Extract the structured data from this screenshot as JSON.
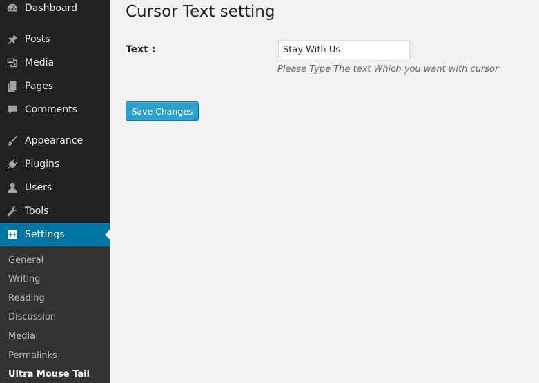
{
  "sidebar": {
    "items": [
      {
        "label": "Dashboard",
        "icon": "dashboard-icon"
      },
      {
        "label": "Posts",
        "icon": "pin-icon"
      },
      {
        "label": "Media",
        "icon": "media-icon"
      },
      {
        "label": "Pages",
        "icon": "pages-icon"
      },
      {
        "label": "Comments",
        "icon": "comment-icon"
      },
      {
        "label": "Appearance",
        "icon": "brush-icon"
      },
      {
        "label": "Plugins",
        "icon": "plug-icon"
      },
      {
        "label": "Users",
        "icon": "user-icon"
      },
      {
        "label": "Tools",
        "icon": "wrench-icon"
      },
      {
        "label": "Settings",
        "icon": "settings-icon",
        "active": true
      }
    ],
    "submenu": [
      {
        "label": "General"
      },
      {
        "label": "Writing"
      },
      {
        "label": "Reading"
      },
      {
        "label": "Discussion"
      },
      {
        "label": "Media"
      },
      {
        "label": "Permalinks"
      },
      {
        "label": "Ultra Mouse Tail",
        "current": true
      }
    ]
  },
  "main": {
    "title": "Cursor Text setting",
    "field": {
      "label": "Text :",
      "value": "Stay With Us",
      "description": "Please Type The text Which you want with cursor"
    },
    "save_label": "Save Changes"
  },
  "colors": {
    "sidebar_bg": "#222222",
    "submenu_bg": "#333333",
    "active_bg": "#0074a2",
    "button_bg": "#2ea2cc",
    "page_bg": "#f1f1f1"
  }
}
